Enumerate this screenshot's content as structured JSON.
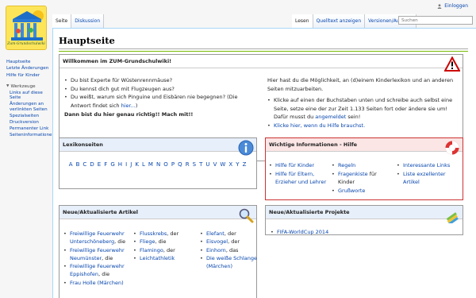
{
  "personal": {
    "login": "Einloggen"
  },
  "tabs": {
    "left": [
      "Seite",
      "Diskussion"
    ],
    "right": [
      "Lesen",
      "Quelltext anzeigen",
      "Versionen/Autoren"
    ]
  },
  "search": {
    "placeholder": "Suchen"
  },
  "logo": {
    "caption": "Zum-Grundschulwiki"
  },
  "sidebar": {
    "nav": [
      "Hauptseite",
      "Letzte Änderungen",
      "Hilfe für Kinder"
    ],
    "tools_heading": "Werkzeuge",
    "tools": [
      "Links auf diese Seite",
      "Änderungen an verlinkten Seiten",
      "Spezialseiten",
      "Druckversion",
      "Permanenter Link",
      "Seiteninformationen"
    ]
  },
  "page": {
    "title": "Hauptseite"
  },
  "welcome": {
    "heading": "Willkommen im ZUM-Grundschulwiki!",
    "questions": [
      "Du bist Experte für Wüstenrennmäuse?",
      "Du kennst dich gut mit Flugzeugen aus?",
      "Du weißt, warum sich Pinguine und Eisbären nie begegnen? (Die Antwort findet sich "
    ],
    "answer_link": "hier...",
    "answer_close": ")",
    "conclusion": "Dann bist du hier genau richtig!! Mach mit!!",
    "intro": "Hier hast du die Möglichkeit, an (d)einem Kinderlexikon und an anderen Seiten mitzuarbeiten.",
    "bullet1": "Klicke auf einen der Buchstaben unten und schreibe auch selbst eine Seite, setze eine der zur Zeit 1.133 Seiten fort oder ändere sie um! Dafür musst du ",
    "bullet1_link": "angemeldet",
    "bullet1_end": " sein!",
    "bullet2": "Klicke hier, wenn du Hilfe brauchst."
  },
  "lexikon": {
    "heading": "Lexikonseiten",
    "letters": [
      "A",
      "B",
      "C",
      "D",
      "E",
      "F",
      "G",
      "H",
      "I",
      "J",
      "K",
      "L",
      "M",
      "N",
      "O",
      "P",
      "Q",
      "R",
      "S",
      "T",
      "U",
      "V",
      "W",
      "X",
      "Y",
      "Z"
    ]
  },
  "info": {
    "heading": "Wichtige Informationen - Hilfe",
    "col1": [
      "Hilfe für Kinder",
      "Hilfe für Eltern, Erzieher und Lehrer"
    ],
    "col2_a": "Regeln",
    "col2_b_link": "Fragenkiste",
    "col2_b_text": " für Kinder",
    "col2_c": "Grußworte",
    "col3": [
      "Interessante Links",
      "Liste exzellenter Artikel"
    ]
  },
  "neu": {
    "heading": "Neue/Aktualisierte Artikel",
    "col1": [
      {
        "link": "Freiwillige Feuerwehr Unterschöneberg",
        "suffix": ", die"
      },
      {
        "link": "Freiwillige Feuerwehr Neumünster",
        "suffix": ", die"
      },
      {
        "link": "Freiwillige Feuerwehr Eppishofen",
        "suffix": ", die"
      },
      {
        "link": "Frau Holle (Märchen)",
        "suffix": ""
      }
    ],
    "col2": [
      {
        "link": "Flusskrebs",
        "suffix": ", der"
      },
      {
        "link": "Fliege",
        "suffix": ", die"
      },
      {
        "link": "Flamingo",
        "suffix": ", der"
      },
      {
        "link": "Leichtathletik",
        "suffix": ""
      }
    ],
    "col3": [
      {
        "link": "Elefant",
        "suffix": ", der"
      },
      {
        "link": "Eisvogel",
        "suffix": ", der"
      },
      {
        "link": "Einhorn",
        "suffix": ", das"
      },
      {
        "link": "Die weiße Schlange (Märchen)",
        "suffix": ""
      }
    ]
  },
  "projekte": {
    "heading": "Neue/Aktualisierte Projekte",
    "items": [
      "FIFA-WorldCup 2014"
    ]
  },
  "colors": {
    "link": "#0645ad",
    "accent_green": "#76b900",
    "info_border": "#cc3333",
    "logo_yellow": "#fde55a"
  }
}
